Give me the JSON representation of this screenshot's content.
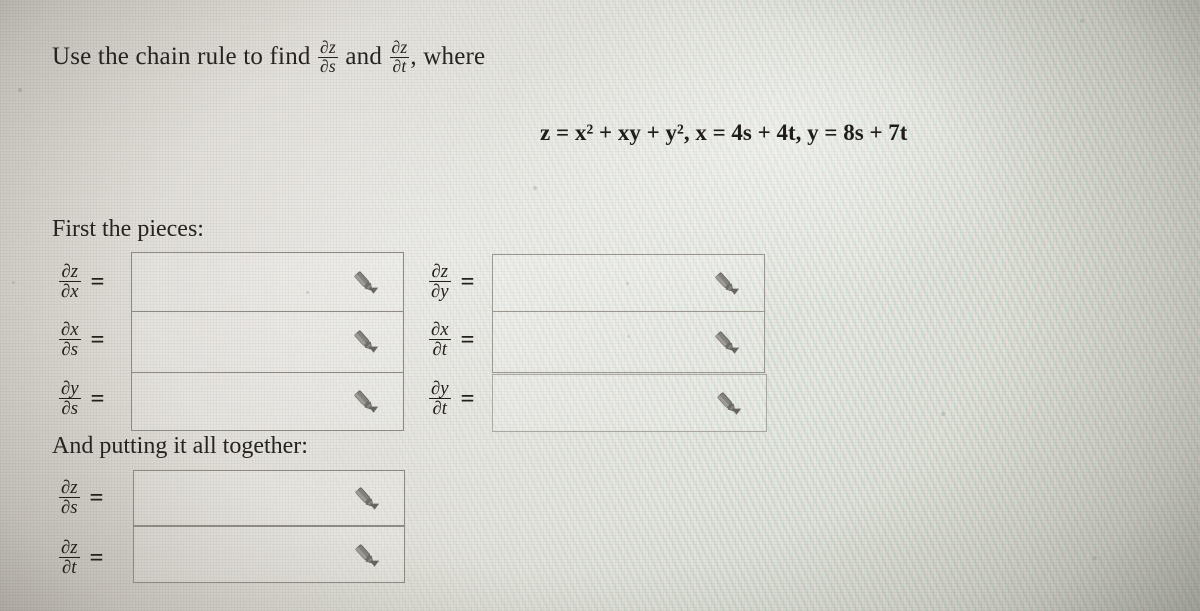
{
  "problem": {
    "prompt_parts": {
      "before": "Use the chain rule to find",
      "frac1_num": "∂z",
      "frac1_den": "∂s",
      "middle": "and",
      "frac2_num": "∂z",
      "frac2_den": "∂t",
      "after": ", where"
    },
    "equation": "z = x² + xy + y², x = 4s + 4t, y = 8s + 7t",
    "section_pieces_label": "First the pieces:",
    "section_together_label": "And putting it all together:"
  },
  "pieces": {
    "left_column": [
      {
        "num": "∂z",
        "den": "∂x",
        "equals": "=",
        "value": "",
        "editor_icon": "pencil-icon"
      },
      {
        "num": "∂x",
        "den": "∂s",
        "equals": "=",
        "value": "",
        "editor_icon": "pencil-icon"
      },
      {
        "num": "∂y",
        "den": "∂s",
        "equals": "=",
        "value": "",
        "editor_icon": "pencil-icon"
      }
    ],
    "right_column": [
      {
        "num": "∂z",
        "den": "∂y",
        "equals": "=",
        "value": "",
        "editor_icon": "pencil-icon"
      },
      {
        "num": "∂x",
        "den": "∂t",
        "equals": "=",
        "value": "",
        "editor_icon": "pencil-icon"
      },
      {
        "num": "∂y",
        "den": "∂t",
        "equals": "=",
        "value": "",
        "editor_icon": "pencil-icon"
      }
    ]
  },
  "together": [
    {
      "num": "∂z",
      "den": "∂s",
      "equals": "=",
      "value": "",
      "editor_icon": "pencil-icon"
    },
    {
      "num": "∂z",
      "den": "∂t",
      "equals": "=",
      "value": "",
      "editor_icon": "pencil-icon"
    }
  ],
  "colors": {
    "text": "#262320",
    "box_border": "#8e8a82",
    "page_background": "#e3e1d9",
    "moire_green": "#78d6b0",
    "moire_pink": "#ffc8d6"
  }
}
